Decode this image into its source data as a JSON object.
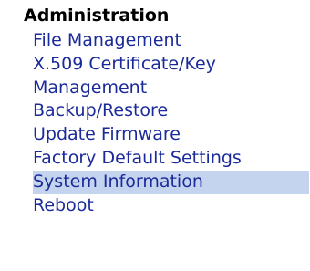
{
  "section": {
    "title": "Administration"
  },
  "menu": {
    "items": [
      {
        "label": "File Management",
        "selected": false
      },
      {
        "label": "X.509 Certificate/Key Management",
        "selected": false
      },
      {
        "label": "Backup/Restore",
        "selected": false
      },
      {
        "label": "Update Firmware",
        "selected": false
      },
      {
        "label": "Factory Default Settings",
        "selected": false
      },
      {
        "label": "System Information",
        "selected": true
      },
      {
        "label": "Reboot",
        "selected": false
      }
    ]
  },
  "colors": {
    "link": "#1a2a9a",
    "selected_background": "#c5d4ee",
    "title": "#000000"
  }
}
